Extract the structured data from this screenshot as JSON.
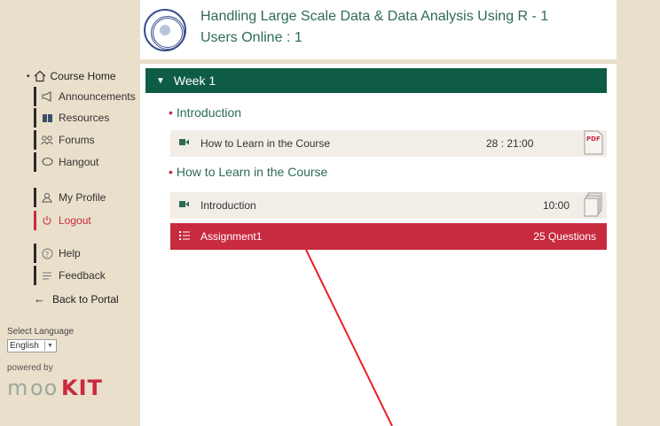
{
  "header": {
    "course_title": "Handling Large Scale Data & Data Analysis Using R - 1",
    "users_online": "Users Online : 1"
  },
  "sidebar": {
    "course_home": "Course Home",
    "items": [
      {
        "label": "Announcements",
        "icon": "megaphone-icon"
      },
      {
        "label": "Resources",
        "icon": "book-icon"
      },
      {
        "label": "Forums",
        "icon": "people-icon"
      },
      {
        "label": "Hangout",
        "icon": "chat-icon"
      },
      {
        "label": "My Profile",
        "icon": "user-icon"
      },
      {
        "label": "Logout",
        "icon": "power-icon"
      },
      {
        "label": "Help",
        "icon": "help-icon"
      },
      {
        "label": "Feedback",
        "icon": "feedback-icon"
      }
    ],
    "back_to_portal": "Back to Portal",
    "select_language_label": "Select Language",
    "language_value": "English",
    "powered_by": "powered by",
    "brand": "mooKIT"
  },
  "main": {
    "week_title": "Week 1",
    "sections": [
      {
        "title": "Introduction",
        "rows": [
          {
            "label": "How to Learn in the Course",
            "duration": "28 : 21:00",
            "doc": "pdf-icon"
          }
        ]
      },
      {
        "title": "How to Learn in the Course",
        "rows": [
          {
            "label": "Introduction",
            "duration": "10:00",
            "doc": "documents-icon"
          },
          {
            "label": "Assignment1",
            "duration": "25 Questions",
            "type": "assignment"
          }
        ]
      }
    ]
  },
  "colors": {
    "accent_green": "#0e5c45",
    "accent_red": "#c82a3f",
    "background": "#eadfcb"
  }
}
